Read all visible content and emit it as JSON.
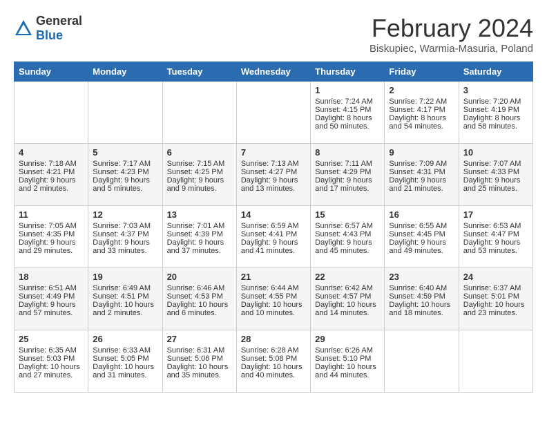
{
  "header": {
    "logo_general": "General",
    "logo_blue": "Blue",
    "month_title": "February 2024",
    "location": "Biskupiec, Warmia-Masuria, Poland"
  },
  "weekdays": [
    "Sunday",
    "Monday",
    "Tuesday",
    "Wednesday",
    "Thursday",
    "Friday",
    "Saturday"
  ],
  "weeks": [
    [
      {
        "day": "",
        "sunrise": "",
        "sunset": "",
        "daylight": ""
      },
      {
        "day": "",
        "sunrise": "",
        "sunset": "",
        "daylight": ""
      },
      {
        "day": "",
        "sunrise": "",
        "sunset": "",
        "daylight": ""
      },
      {
        "day": "",
        "sunrise": "",
        "sunset": "",
        "daylight": ""
      },
      {
        "day": "1",
        "sunrise": "Sunrise: 7:24 AM",
        "sunset": "Sunset: 4:15 PM",
        "daylight": "Daylight: 8 hours and 50 minutes."
      },
      {
        "day": "2",
        "sunrise": "Sunrise: 7:22 AM",
        "sunset": "Sunset: 4:17 PM",
        "daylight": "Daylight: 8 hours and 54 minutes."
      },
      {
        "day": "3",
        "sunrise": "Sunrise: 7:20 AM",
        "sunset": "Sunset: 4:19 PM",
        "daylight": "Daylight: 8 hours and 58 minutes."
      }
    ],
    [
      {
        "day": "4",
        "sunrise": "Sunrise: 7:18 AM",
        "sunset": "Sunset: 4:21 PM",
        "daylight": "Daylight: 9 hours and 2 minutes."
      },
      {
        "day": "5",
        "sunrise": "Sunrise: 7:17 AM",
        "sunset": "Sunset: 4:23 PM",
        "daylight": "Daylight: 9 hours and 5 minutes."
      },
      {
        "day": "6",
        "sunrise": "Sunrise: 7:15 AM",
        "sunset": "Sunset: 4:25 PM",
        "daylight": "Daylight: 9 hours and 9 minutes."
      },
      {
        "day": "7",
        "sunrise": "Sunrise: 7:13 AM",
        "sunset": "Sunset: 4:27 PM",
        "daylight": "Daylight: 9 hours and 13 minutes."
      },
      {
        "day": "8",
        "sunrise": "Sunrise: 7:11 AM",
        "sunset": "Sunset: 4:29 PM",
        "daylight": "Daylight: 9 hours and 17 minutes."
      },
      {
        "day": "9",
        "sunrise": "Sunrise: 7:09 AM",
        "sunset": "Sunset: 4:31 PM",
        "daylight": "Daylight: 9 hours and 21 minutes."
      },
      {
        "day": "10",
        "sunrise": "Sunrise: 7:07 AM",
        "sunset": "Sunset: 4:33 PM",
        "daylight": "Daylight: 9 hours and 25 minutes."
      }
    ],
    [
      {
        "day": "11",
        "sunrise": "Sunrise: 7:05 AM",
        "sunset": "Sunset: 4:35 PM",
        "daylight": "Daylight: 9 hours and 29 minutes."
      },
      {
        "day": "12",
        "sunrise": "Sunrise: 7:03 AM",
        "sunset": "Sunset: 4:37 PM",
        "daylight": "Daylight: 9 hours and 33 minutes."
      },
      {
        "day": "13",
        "sunrise": "Sunrise: 7:01 AM",
        "sunset": "Sunset: 4:39 PM",
        "daylight": "Daylight: 9 hours and 37 minutes."
      },
      {
        "day": "14",
        "sunrise": "Sunrise: 6:59 AM",
        "sunset": "Sunset: 4:41 PM",
        "daylight": "Daylight: 9 hours and 41 minutes."
      },
      {
        "day": "15",
        "sunrise": "Sunrise: 6:57 AM",
        "sunset": "Sunset: 4:43 PM",
        "daylight": "Daylight: 9 hours and 45 minutes."
      },
      {
        "day": "16",
        "sunrise": "Sunrise: 6:55 AM",
        "sunset": "Sunset: 4:45 PM",
        "daylight": "Daylight: 9 hours and 49 minutes."
      },
      {
        "day": "17",
        "sunrise": "Sunrise: 6:53 AM",
        "sunset": "Sunset: 4:47 PM",
        "daylight": "Daylight: 9 hours and 53 minutes."
      }
    ],
    [
      {
        "day": "18",
        "sunrise": "Sunrise: 6:51 AM",
        "sunset": "Sunset: 4:49 PM",
        "daylight": "Daylight: 9 hours and 57 minutes."
      },
      {
        "day": "19",
        "sunrise": "Sunrise: 6:49 AM",
        "sunset": "Sunset: 4:51 PM",
        "daylight": "Daylight: 10 hours and 2 minutes."
      },
      {
        "day": "20",
        "sunrise": "Sunrise: 6:46 AM",
        "sunset": "Sunset: 4:53 PM",
        "daylight": "Daylight: 10 hours and 6 minutes."
      },
      {
        "day": "21",
        "sunrise": "Sunrise: 6:44 AM",
        "sunset": "Sunset: 4:55 PM",
        "daylight": "Daylight: 10 hours and 10 minutes."
      },
      {
        "day": "22",
        "sunrise": "Sunrise: 6:42 AM",
        "sunset": "Sunset: 4:57 PM",
        "daylight": "Daylight: 10 hours and 14 minutes."
      },
      {
        "day": "23",
        "sunrise": "Sunrise: 6:40 AM",
        "sunset": "Sunset: 4:59 PM",
        "daylight": "Daylight: 10 hours and 18 minutes."
      },
      {
        "day": "24",
        "sunrise": "Sunrise: 6:37 AM",
        "sunset": "Sunset: 5:01 PM",
        "daylight": "Daylight: 10 hours and 23 minutes."
      }
    ],
    [
      {
        "day": "25",
        "sunrise": "Sunrise: 6:35 AM",
        "sunset": "Sunset: 5:03 PM",
        "daylight": "Daylight: 10 hours and 27 minutes."
      },
      {
        "day": "26",
        "sunrise": "Sunrise: 6:33 AM",
        "sunset": "Sunset: 5:05 PM",
        "daylight": "Daylight: 10 hours and 31 minutes."
      },
      {
        "day": "27",
        "sunrise": "Sunrise: 6:31 AM",
        "sunset": "Sunset: 5:06 PM",
        "daylight": "Daylight: 10 hours and 35 minutes."
      },
      {
        "day": "28",
        "sunrise": "Sunrise: 6:28 AM",
        "sunset": "Sunset: 5:08 PM",
        "daylight": "Daylight: 10 hours and 40 minutes."
      },
      {
        "day": "29",
        "sunrise": "Sunrise: 6:26 AM",
        "sunset": "Sunset: 5:10 PM",
        "daylight": "Daylight: 10 hours and 44 minutes."
      },
      {
        "day": "",
        "sunrise": "",
        "sunset": "",
        "daylight": ""
      },
      {
        "day": "",
        "sunrise": "",
        "sunset": "",
        "daylight": ""
      }
    ]
  ]
}
